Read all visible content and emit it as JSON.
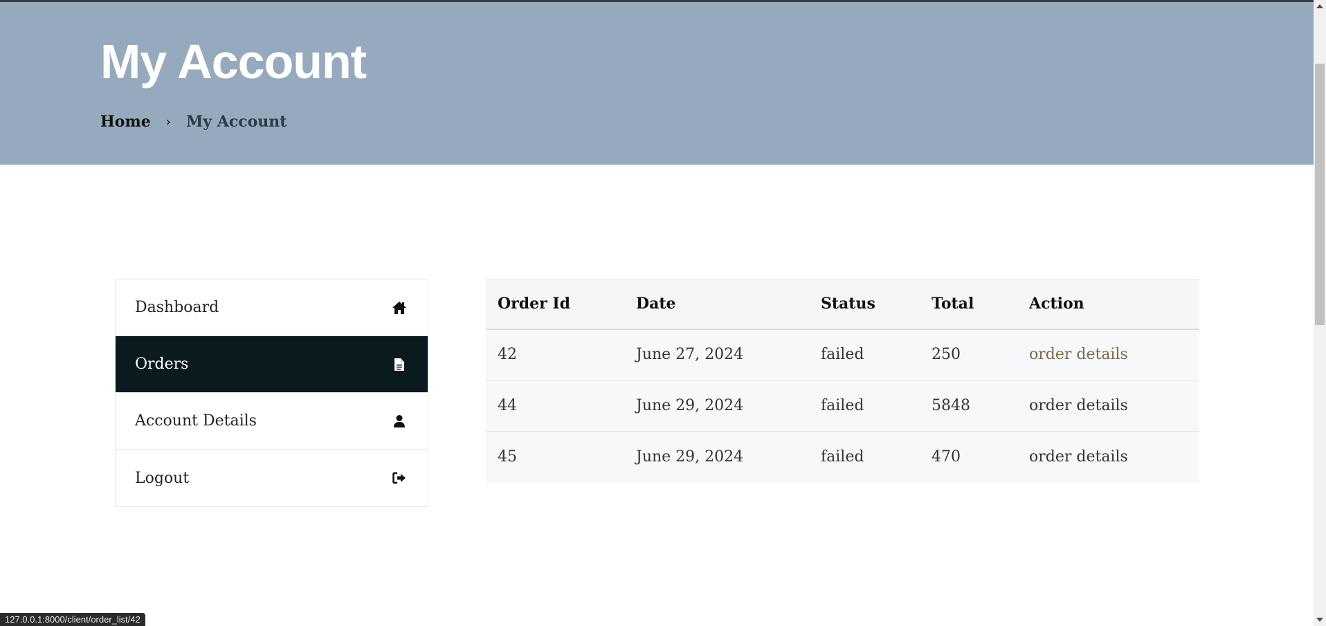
{
  "hero": {
    "title": "My Account",
    "breadcrumb": {
      "home": "Home",
      "separator": "›",
      "current": "My Account"
    }
  },
  "sidebar": {
    "items": [
      {
        "label": "Dashboard",
        "icon": "home-icon",
        "active": false
      },
      {
        "label": "Orders",
        "icon": "document-icon",
        "active": true
      },
      {
        "label": "Account Details",
        "icon": "user-icon",
        "active": false
      },
      {
        "label": "Logout",
        "icon": "logout-icon",
        "active": false
      }
    ]
  },
  "orders": {
    "headers": [
      "Order Id",
      "Date",
      "Status",
      "Total",
      "Action"
    ],
    "rows": [
      {
        "id": "42",
        "date": "June 27, 2024",
        "status": "failed",
        "total": "250",
        "action": "order details"
      },
      {
        "id": "44",
        "date": "June 29, 2024",
        "status": "failed",
        "total": "5848",
        "action": "order details"
      },
      {
        "id": "45",
        "date": "June 29, 2024",
        "status": "failed",
        "total": "470",
        "action": "order details"
      }
    ]
  },
  "status_bar": {
    "url": "127.0.0.1:8000/client/order_list/42"
  },
  "colors": {
    "hero_bg": "#97a9bd",
    "active_bg": "#0a1a1e",
    "link_hover": "#7a6a48"
  }
}
